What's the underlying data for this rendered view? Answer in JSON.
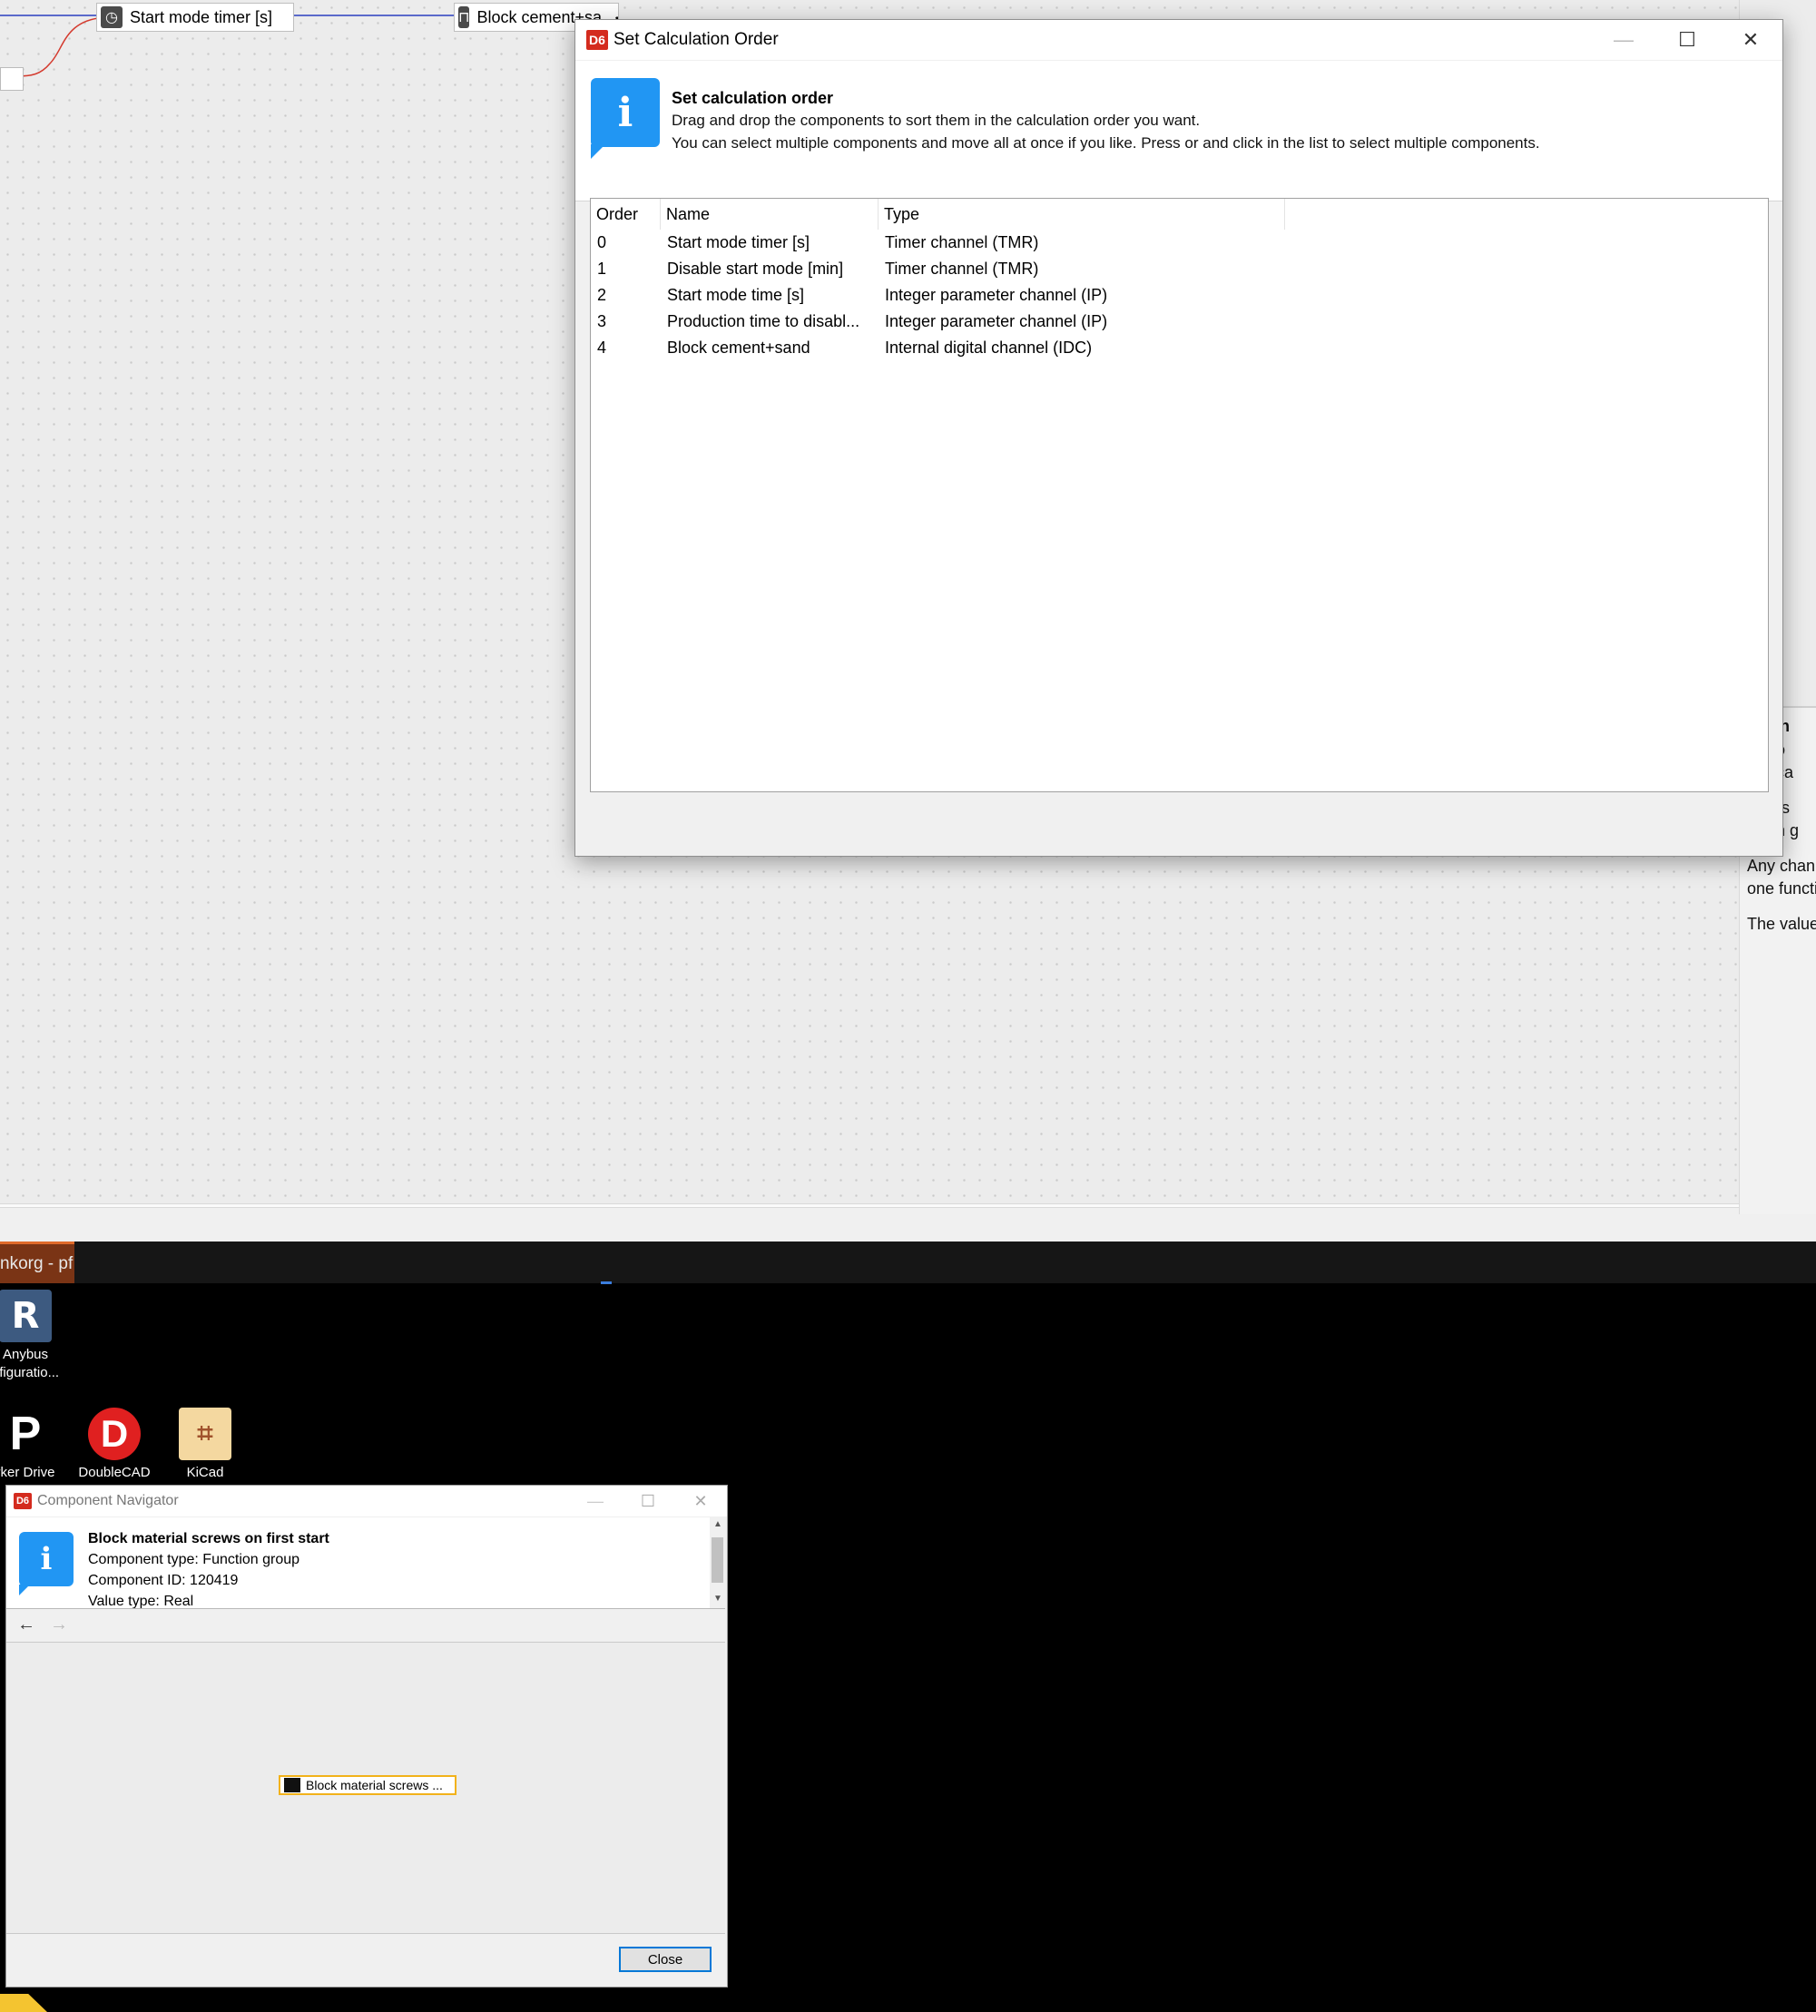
{
  "canvas": {
    "node_timer_label": "Start mode timer [s]",
    "node_timer_icon": "stopwatch-icon",
    "node_block_label": "Block cement+sa",
    "node_block_icon": "digital-signal-icon",
    "link_color": "#2b3fbf",
    "wire_color": "#d43a2e"
  },
  "right_panel": {
    "lines": [
      "ction",
      "nctio",
      "pplica",
      "nnels",
      "ction g",
      "Any chann",
      "one functi",
      "The value"
    ]
  },
  "calc_dialog": {
    "title": "Set Calculation Order",
    "heading": "Set calculation order",
    "line1": "Drag and drop the components to sort them in the calculation order you want.",
    "line2": "You can select multiple components and move all at once if you like. Press or and click in the list to select multiple components.",
    "columns": [
      "Order",
      "Name",
      "Type"
    ],
    "rows": [
      {
        "order": "0",
        "name": "Start mode timer [s]",
        "type": "Timer channel (TMR)"
      },
      {
        "order": "1",
        "name": "Disable start mode [min]",
        "type": "Timer channel (TMR)"
      },
      {
        "order": "2",
        "name": "Start mode time [s]",
        "type": "Integer parameter channel (IP)"
      },
      {
        "order": "3",
        "name": "Production time to disabl...",
        "type": "Integer parameter channel (IP)"
      },
      {
        "order": "4",
        "name": "Block cement+sand",
        "type": "Internal digital channel (IDC)"
      }
    ]
  },
  "taskbar": {
    "active_tab_label": "nkorg - pf",
    "accent": "#e06a2a"
  },
  "desktop": {
    "icons": [
      {
        "label1": "Anybus",
        "label2": "nfiguratio..."
      },
      {
        "label1": "rker Drive",
        "label2": ""
      },
      {
        "label1": "DoubleCAD",
        "label2": ""
      },
      {
        "label1": "KiCad",
        "label2": ""
      }
    ]
  },
  "nav_dialog": {
    "title": "Component Navigator",
    "heading": "Block material screws on first start",
    "type_line": "Component type: Function group",
    "id_line": "Component ID: 120419",
    "value_line": "Value type: Real",
    "node_label": "Block material screws ...",
    "close_label": "Close"
  }
}
